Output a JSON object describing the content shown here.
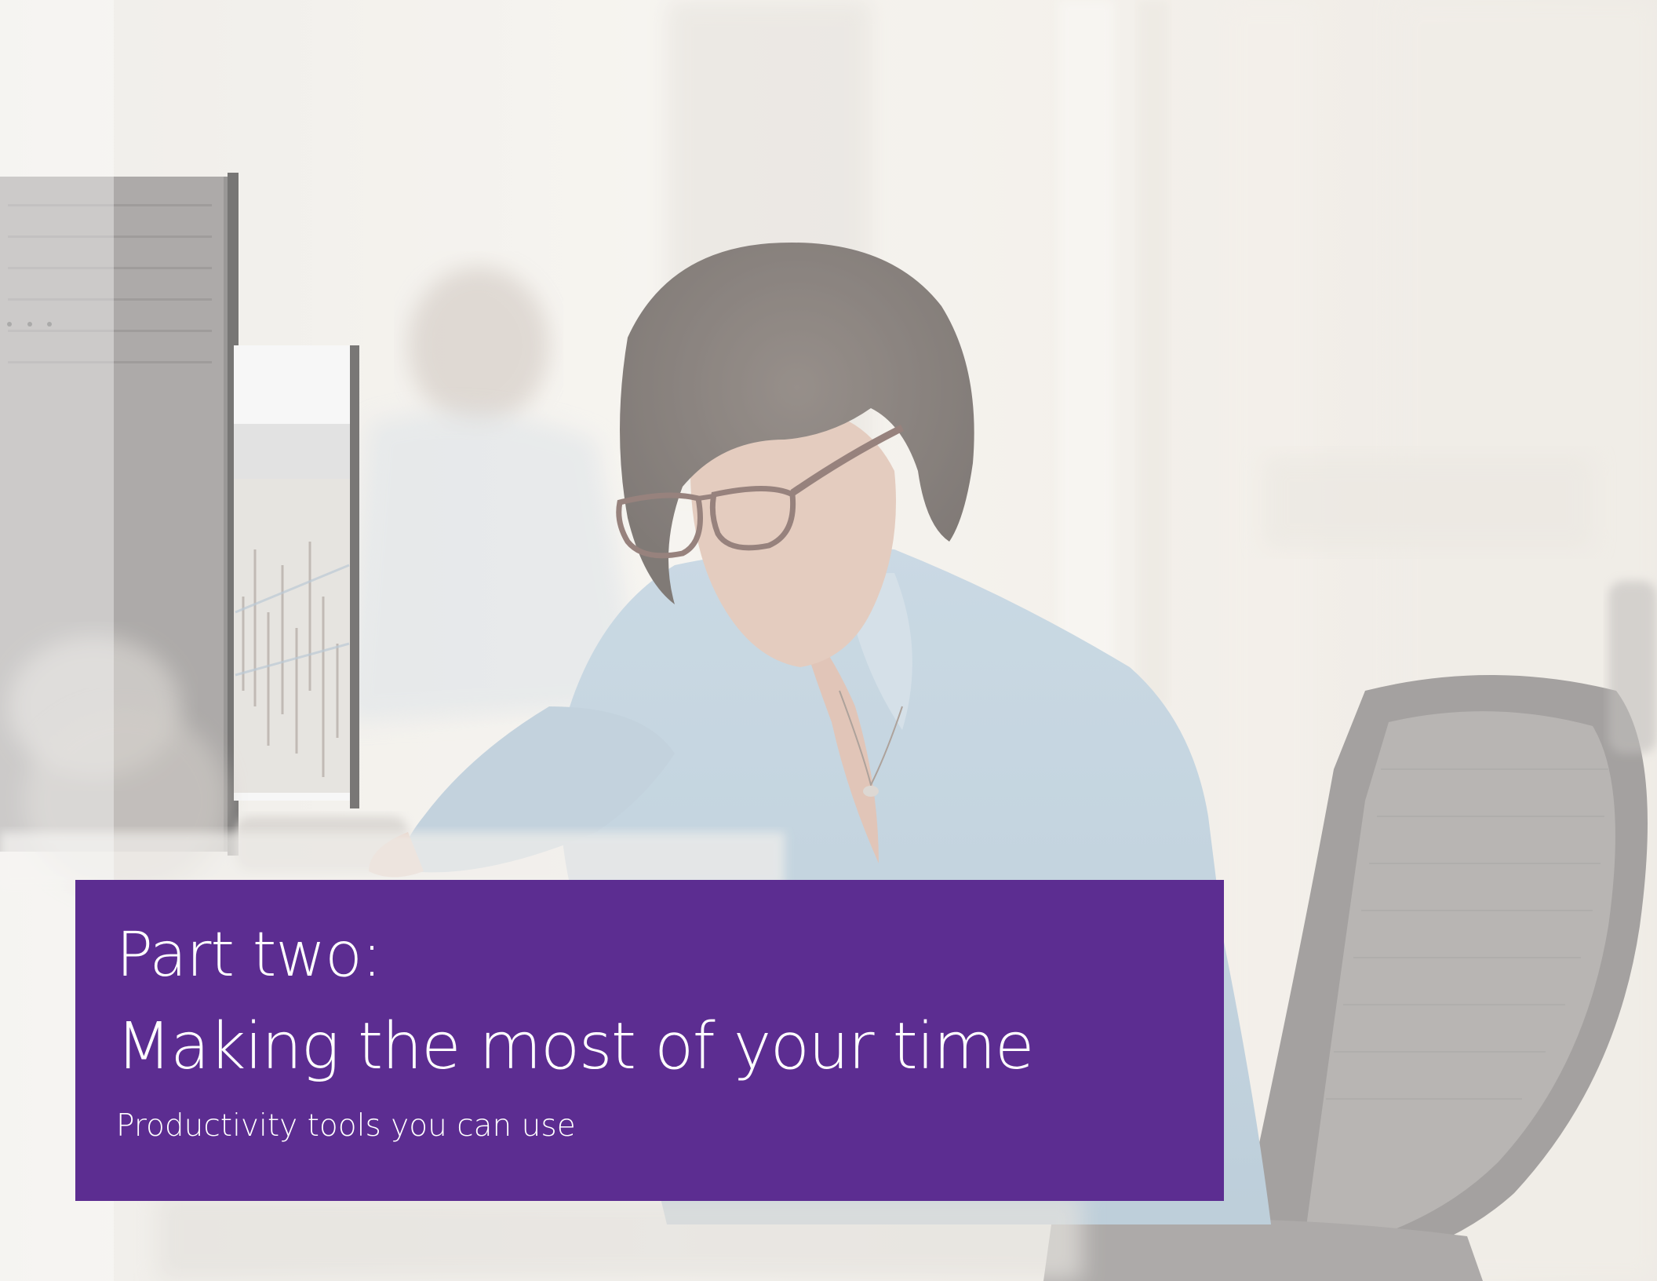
{
  "cover": {
    "kicker": "Part two:",
    "headline": "Making the most of your time",
    "subhead": "Productivity tools you can use",
    "accent_color": "#5c2d91"
  },
  "photo": {
    "subject": "woman with glasses working at a desktop computer in an office, seated in a mesh office chair",
    "tint": "light washed-out overlay"
  }
}
